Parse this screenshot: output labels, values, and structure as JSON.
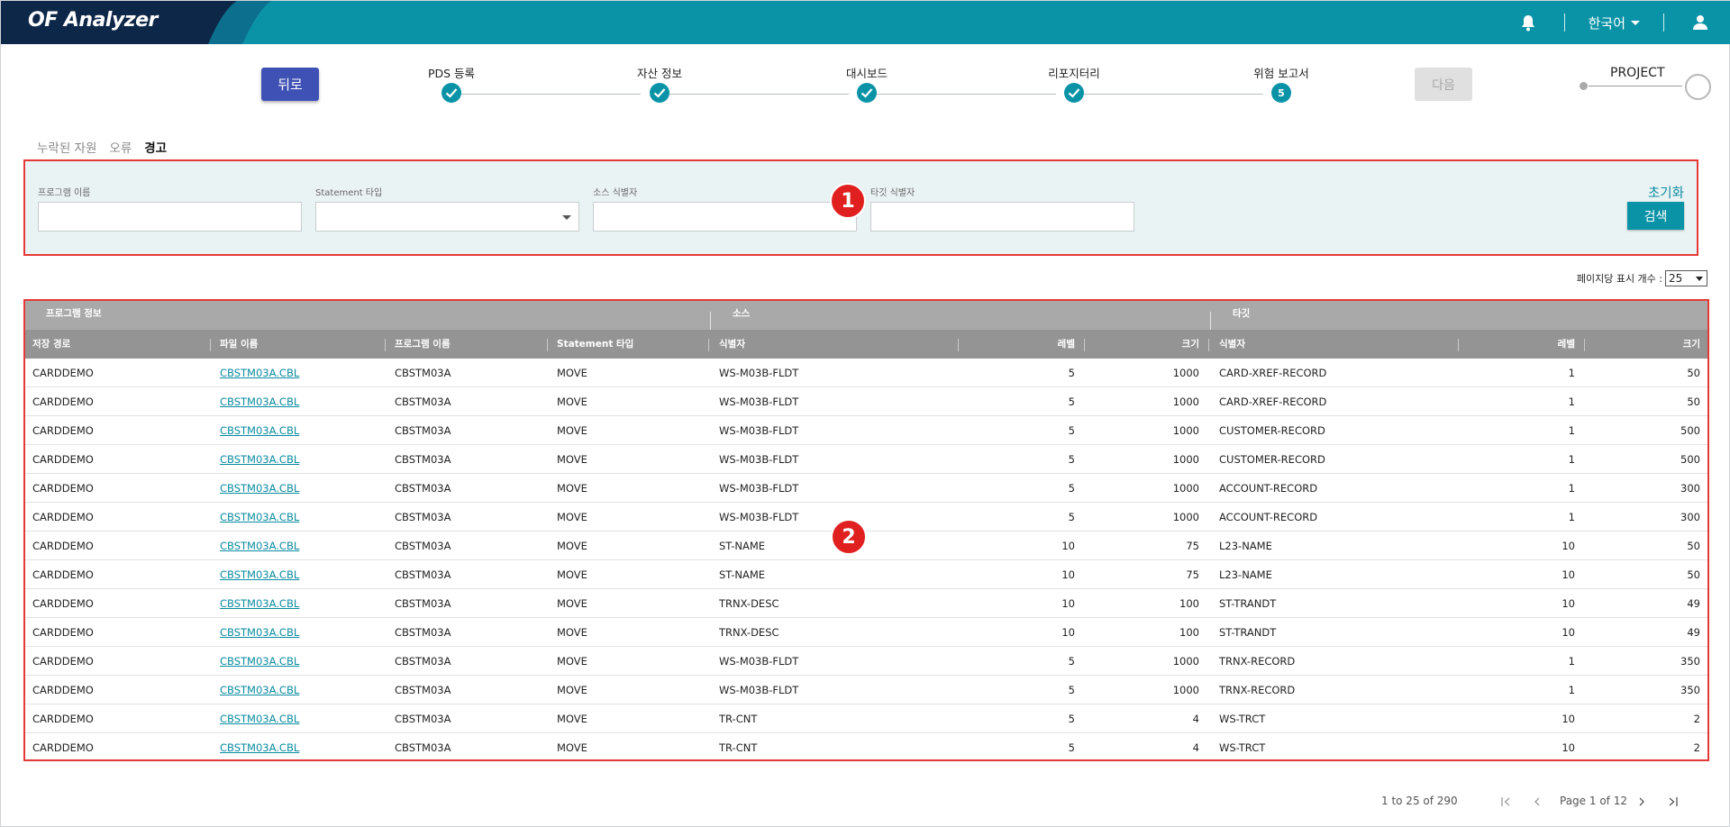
{
  "app": {
    "title": "OF Analyzer",
    "language": "한국어"
  },
  "header": {
    "bell_icon": "bell-icon",
    "user_icon": "user-icon"
  },
  "stepper": {
    "back_label": "뒤로",
    "next_label": "다음",
    "steps": [
      {
        "label": "PDS 등록",
        "state": "done"
      },
      {
        "label": "자산 정보",
        "state": "done"
      },
      {
        "label": "대시보드",
        "state": "done"
      },
      {
        "label": "리포지터리",
        "state": "done"
      },
      {
        "label": "위험 보고서",
        "state": "current",
        "number": "5"
      }
    ],
    "project_label": "PROJECT"
  },
  "tabs": [
    {
      "label": "누락된 자원",
      "active": false
    },
    {
      "label": "오류",
      "active": false
    },
    {
      "label": "경고",
      "active": true
    }
  ],
  "filter": {
    "program_name_label": "프로그램 이름",
    "program_name_value": "",
    "statement_type_label": "Statement 타입",
    "statement_type_value": "",
    "source_id_label": "소스 식별자",
    "source_id_value": "",
    "target_id_label": "타깃 식별자",
    "target_id_value": "",
    "reset_label": "초기화",
    "search_label": "검색"
  },
  "annotations": {
    "badge1": "1",
    "badge2": "2",
    "color": "#e01f1f"
  },
  "page_size": {
    "label": "페이지당 표시 개수 :",
    "value": "25"
  },
  "table": {
    "groups": {
      "program": "프로그램 정보",
      "source": "소스",
      "target": "타깃"
    },
    "columns": {
      "path": "저장 경로",
      "file": "파일 이름",
      "program": "프로그램 이름",
      "stmt": "Statement 타입",
      "src_id": "식별자",
      "src_level": "레벨",
      "src_size": "크기",
      "tgt_id": "식별자",
      "tgt_level": "레벨",
      "tgt_size": "크기"
    },
    "rows": [
      [
        "CARDDEMO",
        "CBSTM03A.CBL",
        "CBSTM03A",
        "MOVE",
        "WS-M03B-FLDT",
        "5",
        "1000",
        "CARD-XREF-RECORD",
        "1",
        "50"
      ],
      [
        "CARDDEMO",
        "CBSTM03A.CBL",
        "CBSTM03A",
        "MOVE",
        "WS-M03B-FLDT",
        "5",
        "1000",
        "CARD-XREF-RECORD",
        "1",
        "50"
      ],
      [
        "CARDDEMO",
        "CBSTM03A.CBL",
        "CBSTM03A",
        "MOVE",
        "WS-M03B-FLDT",
        "5",
        "1000",
        "CUSTOMER-RECORD",
        "1",
        "500"
      ],
      [
        "CARDDEMO",
        "CBSTM03A.CBL",
        "CBSTM03A",
        "MOVE",
        "WS-M03B-FLDT",
        "5",
        "1000",
        "CUSTOMER-RECORD",
        "1",
        "500"
      ],
      [
        "CARDDEMO",
        "CBSTM03A.CBL",
        "CBSTM03A",
        "MOVE",
        "WS-M03B-FLDT",
        "5",
        "1000",
        "ACCOUNT-RECORD",
        "1",
        "300"
      ],
      [
        "CARDDEMO",
        "CBSTM03A.CBL",
        "CBSTM03A",
        "MOVE",
        "WS-M03B-FLDT",
        "5",
        "1000",
        "ACCOUNT-RECORD",
        "1",
        "300"
      ],
      [
        "CARDDEMO",
        "CBSTM03A.CBL",
        "CBSTM03A",
        "MOVE",
        "ST-NAME",
        "10",
        "75",
        "L23-NAME",
        "10",
        "50"
      ],
      [
        "CARDDEMO",
        "CBSTM03A.CBL",
        "CBSTM03A",
        "MOVE",
        "ST-NAME",
        "10",
        "75",
        "L23-NAME",
        "10",
        "50"
      ],
      [
        "CARDDEMO",
        "CBSTM03A.CBL",
        "CBSTM03A",
        "MOVE",
        "TRNX-DESC",
        "10",
        "100",
        "ST-TRANDT",
        "10",
        "49"
      ],
      [
        "CARDDEMO",
        "CBSTM03A.CBL",
        "CBSTM03A",
        "MOVE",
        "TRNX-DESC",
        "10",
        "100",
        "ST-TRANDT",
        "10",
        "49"
      ],
      [
        "CARDDEMO",
        "CBSTM03A.CBL",
        "CBSTM03A",
        "MOVE",
        "WS-M03B-FLDT",
        "5",
        "1000",
        "TRNX-RECORD",
        "1",
        "350"
      ],
      [
        "CARDDEMO",
        "CBSTM03A.CBL",
        "CBSTM03A",
        "MOVE",
        "WS-M03B-FLDT",
        "5",
        "1000",
        "TRNX-RECORD",
        "1",
        "350"
      ],
      [
        "CARDDEMO",
        "CBSTM03A.CBL",
        "CBSTM03A",
        "MOVE",
        "TR-CNT",
        "5",
        "4",
        "WS-TRCT",
        "10",
        "2"
      ],
      [
        "CARDDEMO",
        "CBSTM03A.CBL",
        "CBSTM03A",
        "MOVE",
        "TR-CNT",
        "5",
        "4",
        "WS-TRCT",
        "10",
        "2"
      ]
    ]
  },
  "pager": {
    "summary": "1 to 25 of 290",
    "page": "Page 1 of 12"
  },
  "colors": {
    "brand": "#0a93a6",
    "brand_dark": "#0d2748",
    "back_button": "#3f51b5",
    "highlight": "#e53935"
  }
}
